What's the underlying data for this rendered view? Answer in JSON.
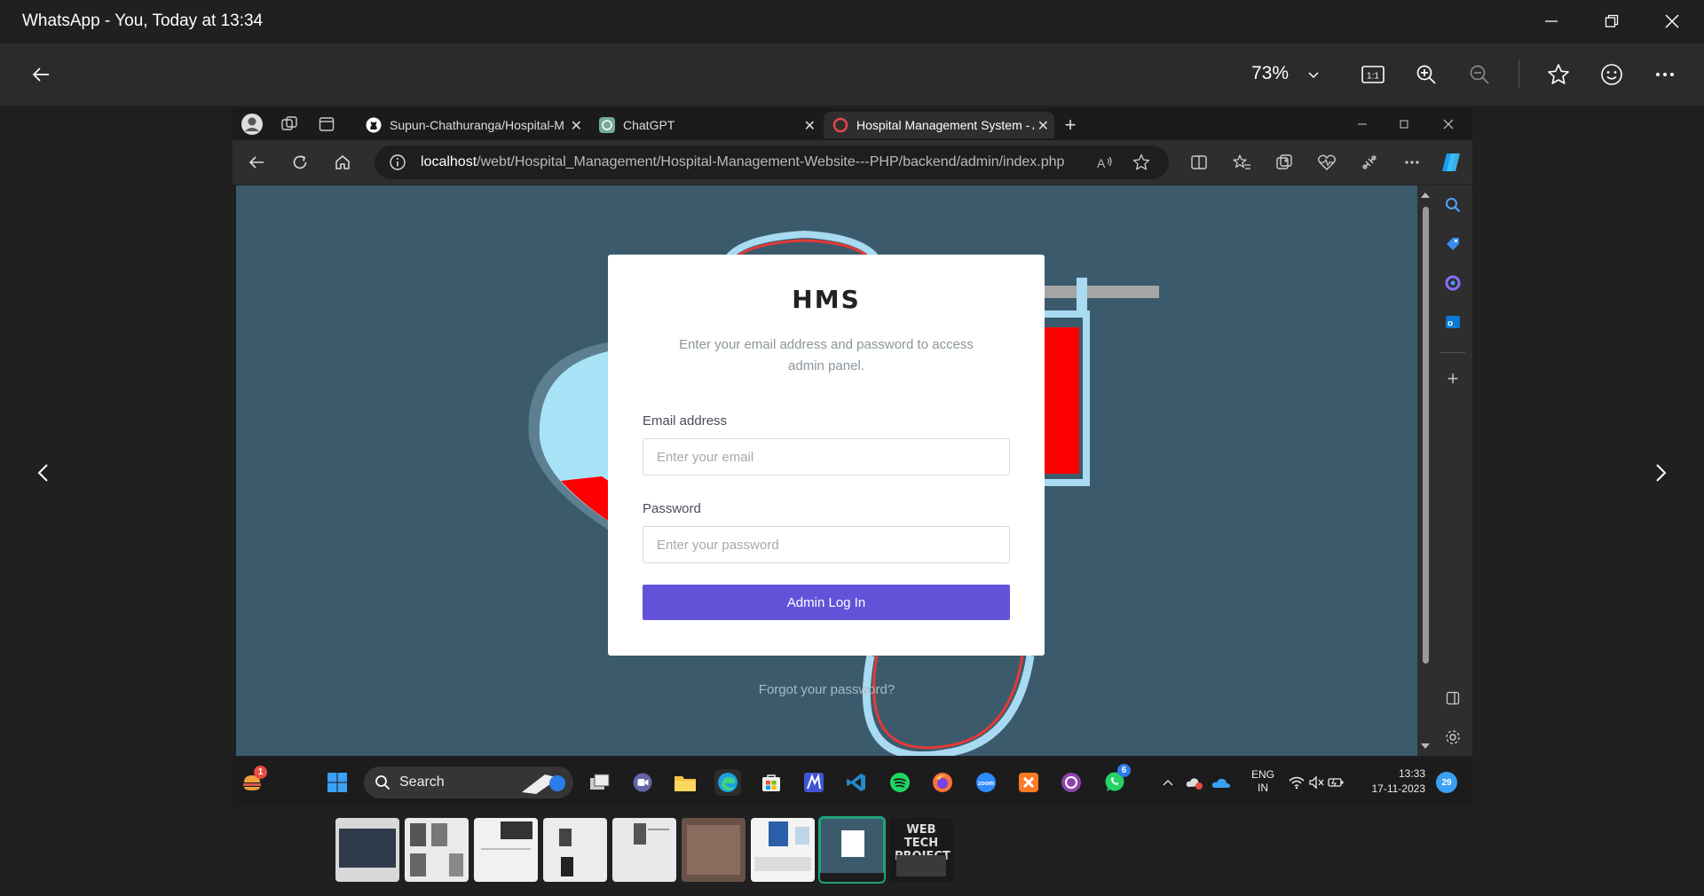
{
  "window": {
    "title": "WhatsApp - You, Today at 13:34"
  },
  "viewer_toolbar": {
    "zoom": "73%"
  },
  "browser": {
    "tabs": [
      {
        "label": "Supun-Chathuranga/Hospital-M"
      },
      {
        "label": "ChatGPT"
      },
      {
        "label": "Hospital Management System - A"
      }
    ],
    "url_host": "localhost",
    "url_path": "/webt/Hospital_Management/Hospital-Management-Website---PHP/backend/admin/index.php"
  },
  "login": {
    "logo": "HMS",
    "subtitle": "Enter your email address and password to access admin panel.",
    "email_label": "Email address",
    "email_placeholder": "Enter your email",
    "password_label": "Password",
    "password_placeholder": "Enter your password",
    "button_label": "Admin Log In",
    "forgot": "Forgot your password?"
  },
  "taskbar": {
    "search_label": "Search",
    "widget_badge": "1",
    "whatsapp_badge": "6",
    "lang_top": "ENG",
    "lang_bottom": "IN",
    "time": "13:33",
    "date": "17-11-2023",
    "notif_count": "29"
  },
  "thumbnail_text": "WEB TECH PROJECT",
  "colors": {
    "page_bg": "#3b5b6d",
    "button": "#6353d9",
    "blood_red": "#ff0000",
    "light_blue": "#a8daf2"
  }
}
